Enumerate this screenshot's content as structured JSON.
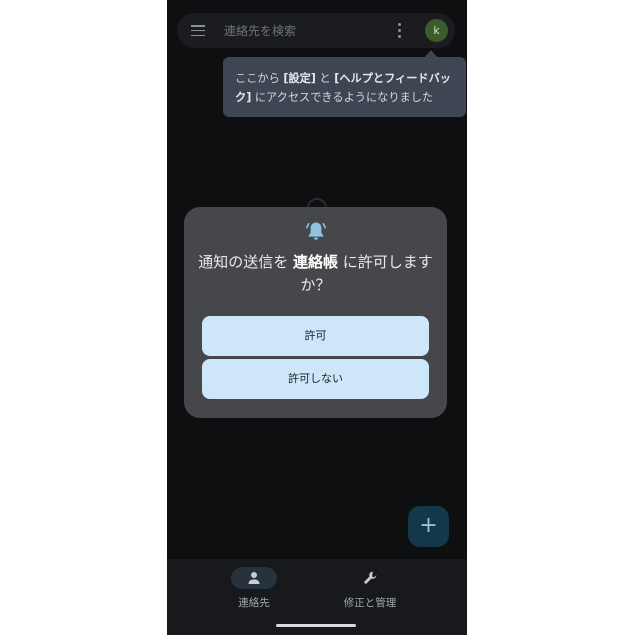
{
  "search": {
    "placeholder": "連絡先を検索"
  },
  "account": {
    "avatar_letter": "k"
  },
  "tooltip": {
    "parts": [
      "ここから ",
      "[設定]",
      " と ",
      "[ヘルプとフィードバック]",
      " にアクセスできるようになりました"
    ]
  },
  "dialog": {
    "title_prefix": "通知の送信を ",
    "app_name": "連絡帳",
    "title_suffix": " に許可しますか？",
    "allow_label": "許可",
    "deny_label": "許可しない"
  },
  "fab": {
    "symbol": "+"
  },
  "bottom_nav": {
    "items": [
      {
        "label": "連絡先",
        "icon": "person-icon",
        "selected": true
      },
      {
        "label": "修正と管理",
        "icon": "wrench-icon",
        "selected": false
      }
    ]
  },
  "colors": {
    "background": "#0e0f11",
    "dialog": "#45474a",
    "button": "#cde6f8",
    "tooltip": "#3e4654",
    "bell": "#8fc3df"
  }
}
